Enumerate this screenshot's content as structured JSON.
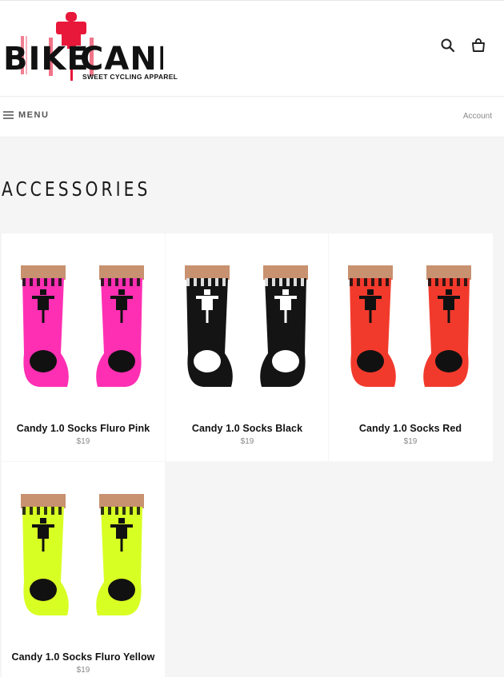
{
  "brand": {
    "logo_word_left": "BIKE",
    "logo_word_right": "CANDY",
    "tagline": "SWEET CYCLING APPAREL",
    "accent_color": "#e8183a"
  },
  "header": {
    "icons": [
      "search-icon",
      "cart-icon"
    ]
  },
  "nav": {
    "menu_label": "MENU",
    "account_label": "Account"
  },
  "page": {
    "title": "ACCESSORIES"
  },
  "products": [
    {
      "title": "Candy 1.0 Socks Fluro Pink",
      "price": "$19",
      "sock_color": "#ff2fb3",
      "band_color": "#ff6fca"
    },
    {
      "title": "Candy 1.0 Socks Black",
      "price": "$19",
      "sock_color": "#141414",
      "band_color": "#ffffff"
    },
    {
      "title": "Candy 1.0 Socks Red",
      "price": "$19",
      "sock_color": "#f23a2c",
      "band_color": "#ff8a80"
    },
    {
      "title": "Candy 1.0 Socks Fluro Yellow",
      "price": "$19",
      "sock_color": "#d8ff24",
      "band_color": "#f3ff9a"
    }
  ]
}
